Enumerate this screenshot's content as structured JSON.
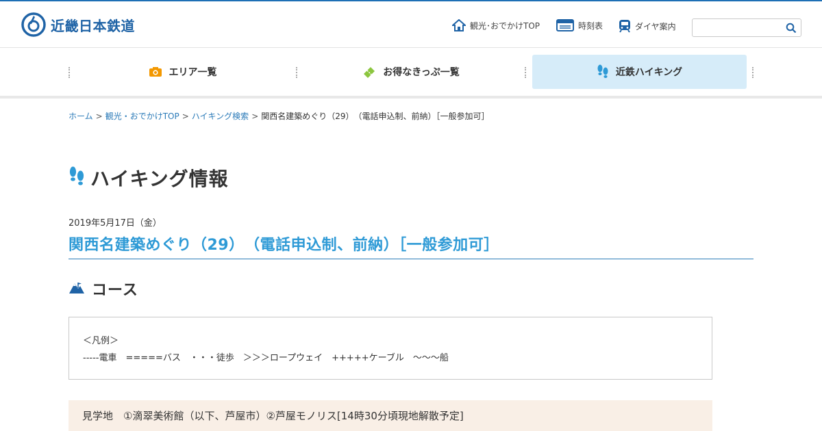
{
  "header": {
    "logo_text": "近畿日本鉄道",
    "nav": [
      {
        "label": "観光･おでかけTOP",
        "icon": "home-icon"
      },
      {
        "label": "時刻表",
        "icon": "timetable-icon"
      },
      {
        "label": "ダイヤ案内",
        "icon": "train-icon"
      }
    ],
    "search": {
      "placeholder": "",
      "value": ""
    }
  },
  "global_nav": [
    {
      "label": "エリア一覧",
      "icon": "camera-icon",
      "color": "#f39800"
    },
    {
      "label": "お得なきっぷ一覧",
      "icon": "ticket-icon",
      "color": "#8cc63f"
    },
    {
      "label": "近鉄ハイキング",
      "icon": "footprints-icon",
      "color": "#2e9ad6",
      "active": true
    }
  ],
  "breadcrumb": {
    "items": [
      "ホーム",
      "観光・おでかけTOP",
      "ハイキング検索"
    ],
    "separator": ">",
    "current": "関西名建築めぐり（29）　（電話申込制、前納）［一般参加可］"
  },
  "page": {
    "heading": "ハイキング情報",
    "date": "2019年5月17日（金）",
    "event_title": "関西名建築めぐり（29）　（電話申込制、前納）［一般参加可］",
    "course_heading": "コース",
    "legend_line1": "＜凡例＞",
    "legend_line2": "-----電車　=====バス　・・・徒歩　＞＞＞ロープウェイ　+++++ケーブル　～～～船",
    "spots": "見学地　①滴翠美術館（以下、芦屋市）②芦屋モノリス[14時30分頃現地解散予定]"
  },
  "colors": {
    "brand": "#1f63a6",
    "accent": "#2e9ad6",
    "orange": "#f39800",
    "green": "#8cc63f"
  }
}
